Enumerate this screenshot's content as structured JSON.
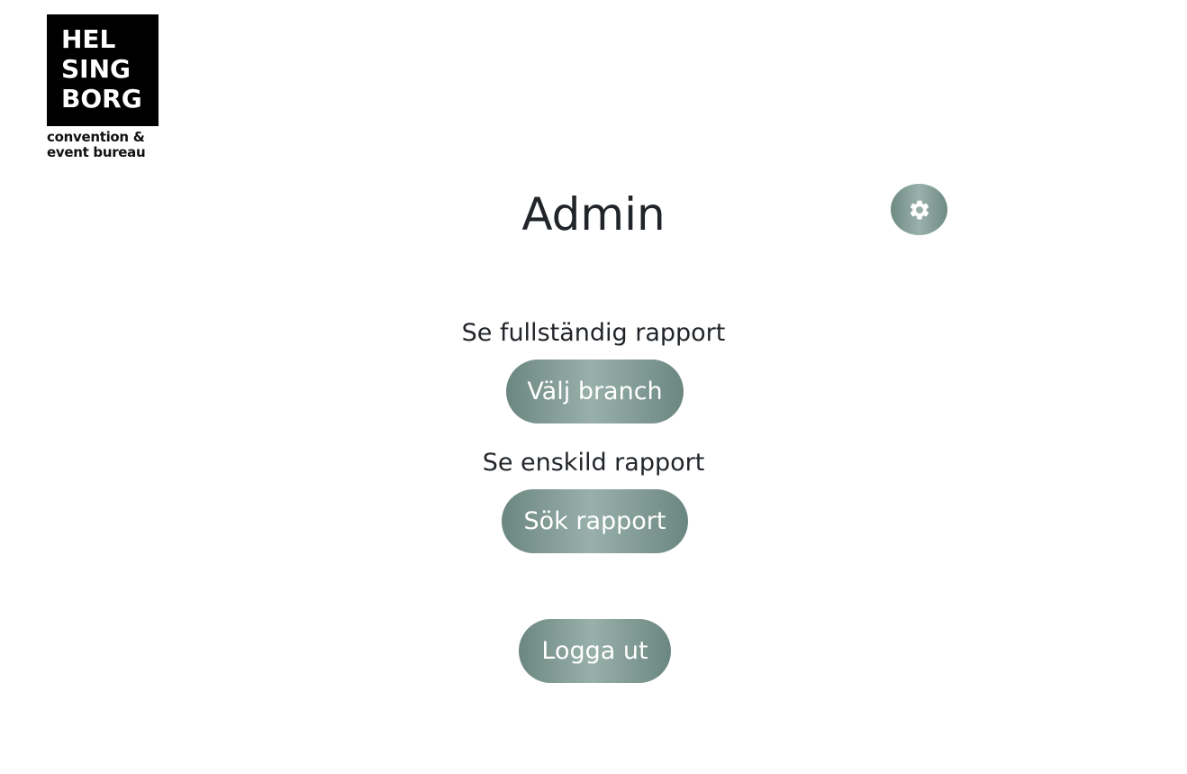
{
  "logo": {
    "lines": [
      "HEL",
      "SING",
      "BORG"
    ],
    "subtitle_lines": [
      "convention &",
      "event bureau"
    ]
  },
  "header": {
    "title": "Admin",
    "settings_icon": "gear-icon"
  },
  "full_report": {
    "label": "Se fullständig rapport",
    "button_label": "Välj branch"
  },
  "single_report": {
    "label": "Se enskild rapport",
    "button_label": "Sök rapport"
  },
  "logout": {
    "button_label": "Logga ut"
  },
  "colors": {
    "button_dark": "#6b8680",
    "button_light": "#99b0aa",
    "text": "#212529"
  }
}
